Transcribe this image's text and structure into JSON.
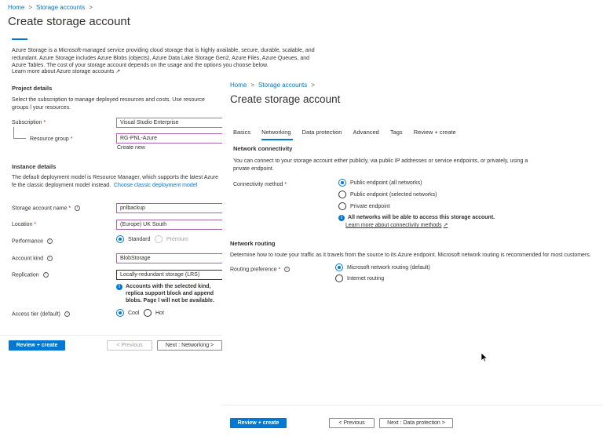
{
  "back": {
    "breadcrumb": {
      "home": "Home",
      "storage": "Storage accounts",
      "sep": ">"
    },
    "title": "Create storage account",
    "intro": "Azure Storage is a Microsoft-managed service providing cloud storage that is highly available, secure, durable, scalable, and redundant. Azure Storage includes Azure Blobs (objects), Azure Data Lake Storage Gen2, Azure Files, Azure Queues, and Azure Tables. The cost of your storage account depends on the usage and the options you choose below.",
    "learn_more": "Learn more about Azure storage accounts",
    "project_details": {
      "heading": "Project details",
      "desc": "Select the subscription to manage deployed resources and costs. Use resource groups l your resources.",
      "subscription_label": "Subscription",
      "subscription_value": "Visual Studio Enterprise",
      "resource_group_label": "Resource group",
      "resource_group_value": "RG-PNL-Azure",
      "create_new": "Create new"
    },
    "instance_details": {
      "heading": "Instance details",
      "desc": "The default deployment model is Resource Manager, which supports the latest Azure fe the classic deployment model instead.",
      "classic_link": "Choose classic deployment model",
      "name_label": "Storage account name",
      "name_value": "pnlbackup",
      "location_label": "Location",
      "location_value": "(Europe) UK South",
      "performance_label": "Performance",
      "performance_options": [
        "Standard",
        "Premium"
      ],
      "kind_label": "Account kind",
      "kind_value": "BlobStorage",
      "replication_label": "Replication",
      "replication_value": "Locally-redundant storage (LRS)",
      "replication_note": "Accounts with the selected kind, replica support block and append blobs. Page l will not be available.",
      "access_tier_label": "Access tier (default)",
      "access_tier_options": [
        "Cool",
        "Hot"
      ]
    },
    "required_mark": "*",
    "buttons": {
      "review": "Review + create",
      "previous": "< Previous",
      "next": "Next : Networking >"
    }
  },
  "front": {
    "breadcrumb": {
      "home": "Home",
      "storage": "Storage accounts",
      "sep": ">"
    },
    "title": "Create storage account",
    "tabs": [
      "Basics",
      "Networking",
      "Data protection",
      "Advanced",
      "Tags",
      "Review + create"
    ],
    "active_tab": "Networking",
    "network_connectivity": {
      "heading": "Network connectivity",
      "desc": "You can connect to your storage account either publicly, via public IP addresses or service endpoints, or privately, using a private endpoint.",
      "method_label": "Connectivity method",
      "options": [
        "Public endpoint (all networks)",
        "Public endpoint (selected networks)",
        "Private endpoint"
      ],
      "selected": "Public endpoint (all networks)",
      "note": "All networks will be able to access this storage account.",
      "note_link": "Learn more about connectivity methods"
    },
    "network_routing": {
      "heading": "Network routing",
      "desc": "Determine how to route your traffic as it travels from the source to its Azure endpoint. Microsoft network routing is recommended for most customers.",
      "pref_label": "Routing preference",
      "options": [
        "Microsoft network routing (default)",
        "Internet routing"
      ],
      "selected": "Microsoft network routing (default)"
    },
    "buttons": {
      "review": "Review + create",
      "previous": "< Previous",
      "next": "Next : Data protection >"
    }
  },
  "colors": {
    "accent": "#0078d4",
    "text": "#323130",
    "required": "#a4262c",
    "focus_border": "#a864a8"
  },
  "icons": {
    "info": "info-circle-icon",
    "external": "external-link-icon",
    "cursor": "mouse-pointer-icon"
  }
}
